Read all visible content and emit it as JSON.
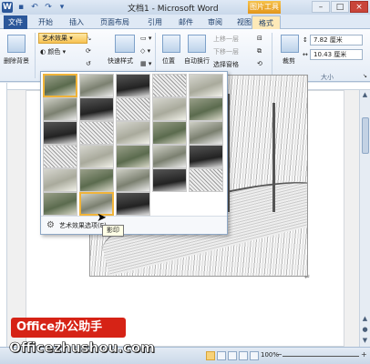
{
  "window": {
    "title": "文档1 - Microsoft Word",
    "context_tab_title": "图片工具",
    "buttons": [
      "–",
      "□",
      "×"
    ]
  },
  "tabs": [
    {
      "label": "文件"
    },
    {
      "label": "开始"
    },
    {
      "label": "插入"
    },
    {
      "label": "页面布局"
    },
    {
      "label": "引用"
    },
    {
      "label": "邮件"
    },
    {
      "label": "审阅"
    },
    {
      "label": "视图"
    },
    {
      "label": "格式"
    }
  ],
  "ribbon": {
    "remove_bg": "删除背景",
    "corrections": "更正",
    "color": "颜色",
    "artistic_effects": "艺术效果",
    "quick_styles": "快速样式",
    "position": "位置",
    "wrap_text": "自动换行",
    "bring_forward": "上移一层",
    "send_backward": "下移一层",
    "selection_pane": "选择窗格",
    "crop": "裁剪",
    "height_value": "7.82 厘米",
    "width_value": "10.43 厘米",
    "size_group": "大小"
  },
  "gallery": {
    "rows": 6,
    "cols": 5,
    "last_row_count": 3,
    "selected_index": 0,
    "hover_index": 26,
    "options_label": "艺术效果选项(E)...",
    "tooltip": "影印"
  },
  "statusbar": {
    "zoom": "100%",
    "minus": "−",
    "plus": "+"
  },
  "watermark": {
    "badge": "Office办公助手",
    "site": "Officezhushou.com"
  }
}
